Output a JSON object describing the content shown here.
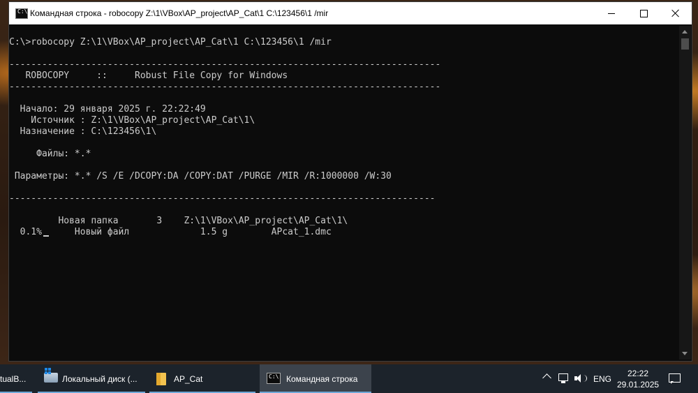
{
  "window": {
    "title": "Командная строка - robocopy  Z:\\1\\VBox\\AP_project\\AP_Cat\\1 C:\\123456\\1 /mir",
    "icon_text": "C:\\"
  },
  "console": {
    "lines": [
      "C:\\>robocopy Z:\\1\\VBox\\AP_project\\AP_Cat\\1 C:\\123456\\1 /mir",
      "",
      "-------------------------------------------------------------------------------",
      "   ROBOCOPY     ::     Robust File Copy for Windows",
      "-------------------------------------------------------------------------------",
      "",
      "  Начало: 29 января 2025 г. 22:22:49",
      "    Источник : Z:\\1\\VBox\\AP_project\\AP_Cat\\1\\",
      "  Назначение : C:\\123456\\1\\",
      "",
      "     Файлы: *.*",
      "",
      " Параметры: *.* /S /E /DCOPY:DA /COPY:DAT /PURGE /MIR /R:1000000 /W:30",
      "",
      "------------------------------------------------------------------------------",
      "",
      "         Новая папка       3    Z:\\1\\VBox\\AP_project\\AP_Cat\\1\\",
      "  0.1%      Новый файл             1.5 g        APcat_1.dmc"
    ]
  },
  "taskbar": {
    "items": [
      {
        "label": "tualB..."
      },
      {
        "label": "Локальный диск (..."
      },
      {
        "label": "AP_Cat"
      },
      {
        "label": "Командная строка"
      }
    ],
    "tray": {
      "language": "ENG",
      "time": "22:22",
      "date": "29.01.2025"
    }
  },
  "colors": {
    "console_bg": "#0c0c0c",
    "console_text": "#cccccc",
    "taskbar_bg": "#1c232b",
    "active_underline": "#6ea7d7"
  },
  "icons": [
    "cmd-icon",
    "minimize-icon",
    "maximize-icon",
    "close-icon",
    "disk-icon",
    "folder-icon",
    "chevron-up-icon",
    "network-icon",
    "volume-icon",
    "notification-icon"
  ]
}
